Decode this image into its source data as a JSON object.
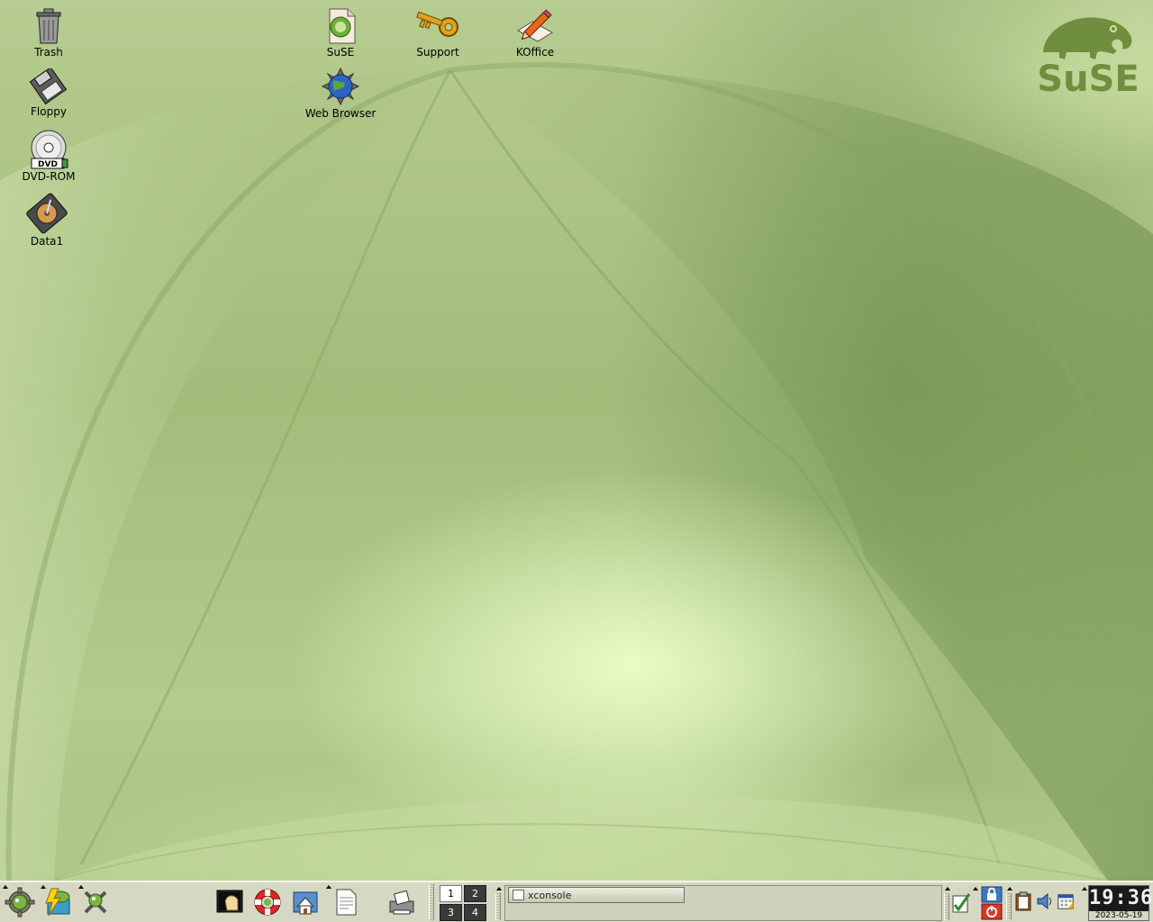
{
  "desktop": {
    "icons": {
      "trash": "Trash",
      "floppy": "Floppy",
      "dvd": "DVD-ROM",
      "data1": "Data1",
      "suse": "SuSE",
      "web_browser": "Web Browser",
      "support": "Support",
      "koffice": "KOffice"
    },
    "dvd_badge": "DVD",
    "logo_text": "SuSE"
  },
  "panel": {
    "pager": [
      "1",
      "2",
      "3",
      "4"
    ],
    "tasks": [
      {
        "label": "xconsole"
      }
    ],
    "clock": {
      "time": "19:36",
      "date": "2023-05-19"
    }
  },
  "colors": {
    "wallpaper": "#a9c283",
    "panel": "#d6d8c4",
    "logo": "#6f8f3e"
  }
}
